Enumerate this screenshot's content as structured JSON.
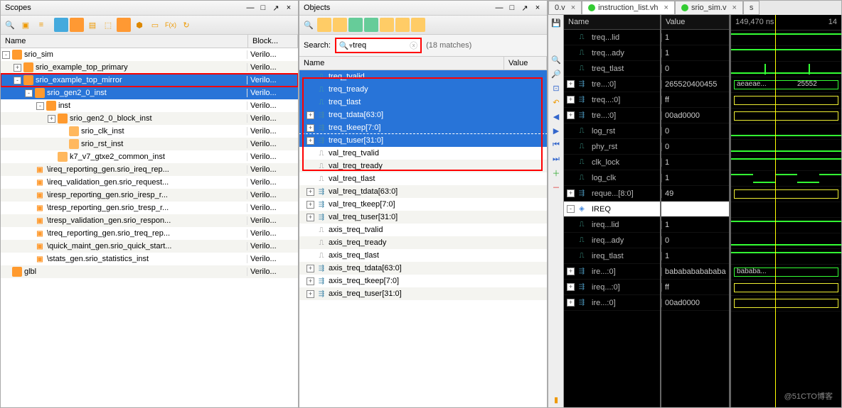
{
  "scopes": {
    "title": "Scopes",
    "columns": {
      "name": "Name",
      "block": "Block..."
    },
    "rows": [
      {
        "indent": 0,
        "exp": "-",
        "icon": "cube",
        "label": "srio_sim",
        "block": "Verilo..."
      },
      {
        "indent": 1,
        "exp": "+",
        "icon": "cube",
        "label": "srio_example_top_primary",
        "block": "Verilo..."
      },
      {
        "indent": 1,
        "exp": "-",
        "icon": "cube",
        "label": "srio_example_top_mirror",
        "block": "Verilo...",
        "selred": true
      },
      {
        "indent": 2,
        "exp": "-",
        "icon": "cube",
        "label": "srio_gen2_0_inst",
        "block": "Verilo...",
        "sel": true
      },
      {
        "indent": 3,
        "exp": "-",
        "icon": "cube",
        "label": "inst",
        "block": "Verilo..."
      },
      {
        "indent": 4,
        "exp": "+",
        "icon": "cube",
        "label": "srio_gen2_0_block_inst",
        "block": "Verilo..."
      },
      {
        "indent": 5,
        "exp": "",
        "icon": "cube2",
        "label": "srio_clk_inst",
        "block": "Verilo..."
      },
      {
        "indent": 5,
        "exp": "",
        "icon": "cube2",
        "label": "srio_rst_inst",
        "block": "Verilo..."
      },
      {
        "indent": 4,
        "exp": "",
        "icon": "cube2",
        "label": "k7_v7_gtxe2_common_inst",
        "block": "Verilo..."
      },
      {
        "indent": 2,
        "exp": "",
        "icon": "bkt",
        "label": "\\ireq_reporting_gen.srio_ireq_rep...",
        "block": "Verilo..."
      },
      {
        "indent": 2,
        "exp": "",
        "icon": "bkt",
        "label": "\\ireq_validation_gen.srio_request...",
        "block": "Verilo..."
      },
      {
        "indent": 2,
        "exp": "",
        "icon": "bkt",
        "label": "\\iresp_reporting_gen.srio_iresp_r...",
        "block": "Verilo..."
      },
      {
        "indent": 2,
        "exp": "",
        "icon": "bkt",
        "label": "\\tresp_reporting_gen.srio_tresp_r...",
        "block": "Verilo..."
      },
      {
        "indent": 2,
        "exp": "",
        "icon": "bkt",
        "label": "\\tresp_validation_gen.srio_respon...",
        "block": "Verilo..."
      },
      {
        "indent": 2,
        "exp": "",
        "icon": "bkt",
        "label": "\\treq_reporting_gen.srio_treq_rep...",
        "block": "Verilo..."
      },
      {
        "indent": 2,
        "exp": "",
        "icon": "bkt",
        "label": "\\quick_maint_gen.srio_quick_start...",
        "block": "Verilo..."
      },
      {
        "indent": 2,
        "exp": "",
        "icon": "bkt",
        "label": "\\stats_gen.srio_statistics_inst",
        "block": "Verilo..."
      },
      {
        "indent": 0,
        "exp": "",
        "icon": "cube",
        "label": "glbl",
        "block": "Verilo..."
      }
    ]
  },
  "objects": {
    "title": "Objects",
    "search_label": "Search:",
    "search_value": "treq",
    "matches": "(18 matches)",
    "columns": {
      "name": "Name",
      "value": "Value"
    },
    "rows": [
      {
        "indent": 0,
        "exp": "",
        "icon": "sig",
        "label": "treq_tvalid",
        "value": "",
        "sel": true
      },
      {
        "indent": 0,
        "exp": "",
        "icon": "sig",
        "label": "treq_tready",
        "value": "",
        "sel": true
      },
      {
        "indent": 0,
        "exp": "",
        "icon": "sig",
        "label": "treq_tlast",
        "value": "",
        "sel": true
      },
      {
        "indent": 0,
        "exp": "+",
        "icon": "bus",
        "label": "treq_tdata[63:0]",
        "value": "",
        "sel": true
      },
      {
        "indent": 0,
        "exp": "+",
        "icon": "bus",
        "label": "treq_tkeep[7:0]",
        "value": "",
        "sel": true
      },
      {
        "indent": 0,
        "exp": "+",
        "icon": "bus",
        "label": "treq_tuser[31:0]",
        "value": "",
        "sel": true,
        "dashed": true
      },
      {
        "indent": 0,
        "exp": "",
        "icon": "sigg",
        "label": "val_treq_tvalid",
        "value": ""
      },
      {
        "indent": 0,
        "exp": "",
        "icon": "sigg",
        "label": "val_treq_tready",
        "value": ""
      },
      {
        "indent": 0,
        "exp": "",
        "icon": "sigg",
        "label": "val_treq_tlast",
        "value": ""
      },
      {
        "indent": 0,
        "exp": "+",
        "icon": "bus",
        "label": "val_treq_tdata[63:0]",
        "value": ""
      },
      {
        "indent": 0,
        "exp": "+",
        "icon": "bus",
        "label": "val_treq_tkeep[7:0]",
        "value": ""
      },
      {
        "indent": 0,
        "exp": "+",
        "icon": "bus",
        "label": "val_treq_tuser[31:0]",
        "value": ""
      },
      {
        "indent": 0,
        "exp": "",
        "icon": "sigg",
        "label": "axis_treq_tvalid",
        "value": ""
      },
      {
        "indent": 0,
        "exp": "",
        "icon": "sigg",
        "label": "axis_treq_tready",
        "value": ""
      },
      {
        "indent": 0,
        "exp": "",
        "icon": "sigg",
        "label": "axis_treq_tlast",
        "value": ""
      },
      {
        "indent": 0,
        "exp": "+",
        "icon": "bus",
        "label": "axis_treq_tdata[63:0]",
        "value": ""
      },
      {
        "indent": 0,
        "exp": "+",
        "icon": "bus",
        "label": "axis_treq_tkeep[7:0]",
        "value": ""
      },
      {
        "indent": 0,
        "exp": "+",
        "icon": "bus",
        "label": "axis_treq_tuser[31:0]",
        "value": ""
      }
    ]
  },
  "wave": {
    "tabs": [
      {
        "label": "0.v",
        "close": true,
        "icon": false
      },
      {
        "label": "instruction_list.vh",
        "close": true,
        "icon": true,
        "act": true
      },
      {
        "label": "srio_sim.v",
        "close": true,
        "icon": true
      },
      {
        "label": "s",
        "close": false,
        "icon": false
      }
    ],
    "header": {
      "name": "Name",
      "value": "Value"
    },
    "ruler_a": "149,470 ns",
    "ruler_b": "14",
    "signals": [
      {
        "exp": "",
        "icon": "sig",
        "name": "treq...lid",
        "value": "1",
        "wf": "hi"
      },
      {
        "exp": "",
        "icon": "sig",
        "name": "treq...ady",
        "value": "1",
        "wf": "hi"
      },
      {
        "exp": "",
        "icon": "sig",
        "name": "treq_tlast",
        "value": "0",
        "wf": "pulse"
      },
      {
        "exp": "+",
        "icon": "bus",
        "name": "tre...:0]",
        "value": "265520400455",
        "wf": "bus",
        "buslbl": "aeaeae...",
        "buslbl2": "25552"
      },
      {
        "exp": "+",
        "icon": "bus",
        "name": "treq...:0]",
        "value": "ff",
        "wf": "busy"
      },
      {
        "exp": "+",
        "icon": "bus",
        "name": "tre...:0]",
        "value": "00ad0000",
        "wf": "busy"
      },
      {
        "exp": "",
        "icon": "sig",
        "name": "log_rst",
        "value": "0",
        "wf": "lo"
      },
      {
        "exp": "",
        "icon": "sig",
        "name": "phy_rst",
        "value": "0",
        "wf": "lo"
      },
      {
        "exp": "",
        "icon": "sig",
        "name": "clk_lock",
        "value": "1",
        "wf": "hi"
      },
      {
        "exp": "",
        "icon": "sig",
        "name": "log_clk",
        "value": "1",
        "wf": "clk"
      },
      {
        "exp": "+",
        "icon": "bus",
        "name": "reque...[8:0]",
        "value": "49",
        "wf": "busy"
      },
      {
        "exp": "-",
        "icon": "grp",
        "name": "IREQ",
        "value": "",
        "wf": "",
        "inv": true
      },
      {
        "exp": "",
        "icon": "sig",
        "name": "ireq...lid",
        "value": "1",
        "wf": "hi"
      },
      {
        "exp": "",
        "icon": "sig",
        "name": "ireq...ady",
        "value": "0",
        "wf": "lo"
      },
      {
        "exp": "",
        "icon": "sig",
        "name": "ireq_tlast",
        "value": "1",
        "wf": "hi"
      },
      {
        "exp": "+",
        "icon": "bus",
        "name": "ire...:0]",
        "value": "bababababababa",
        "wf": "bus",
        "buslbl": "bababa..."
      },
      {
        "exp": "+",
        "icon": "bus",
        "name": "ireq...:0]",
        "value": "ff",
        "wf": "busy"
      },
      {
        "exp": "+",
        "icon": "bus",
        "name": "ire...:0]",
        "value": "00ad0000",
        "wf": "busy"
      }
    ]
  },
  "watermark": "@51CTO博客"
}
